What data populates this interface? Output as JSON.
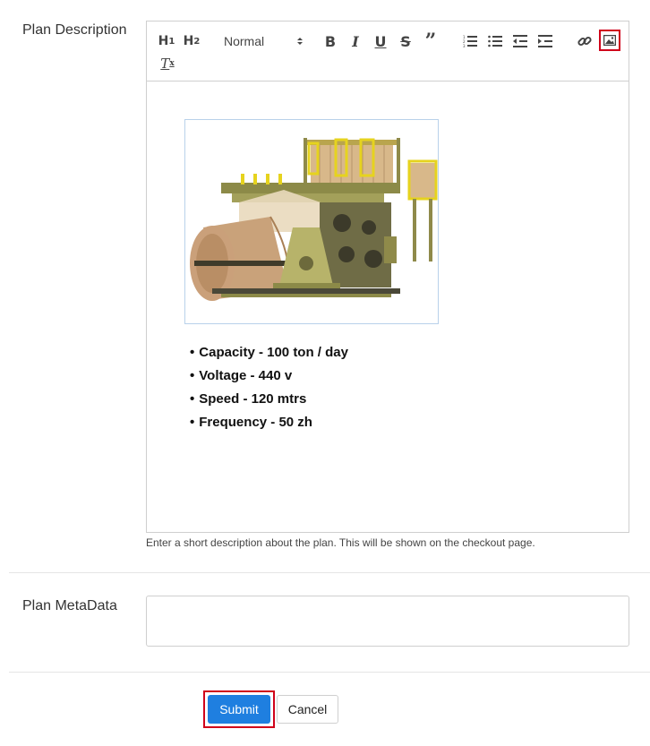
{
  "labels": {
    "plan_description": "Plan Description",
    "plan_metadata": "Plan MetaData"
  },
  "toolbar": {
    "h1": "H",
    "h1_sub": "1",
    "h2": "H",
    "h2_sub": "2",
    "format_select": "Normal",
    "bold": "B",
    "italic": "I",
    "underline": "U",
    "strike": "S",
    "quote": "”",
    "clear": "T",
    "clear_sub": "x",
    "icons": [
      "ordered-list-icon",
      "bullet-list-icon",
      "outdent-icon",
      "indent-icon",
      "link-icon",
      "image-icon",
      "clear-format-icon"
    ]
  },
  "content": {
    "image_description": "industrial paper machine with large kraft paper roll",
    "specs": [
      "Capacity - 100 ton / day",
      "Voltage - 440 v",
      "Speed - 120 mtrs",
      "Frequency - 50 zh"
    ]
  },
  "help_text": "Enter a short description about the plan. This will be shown on the checkout page.",
  "metadata_value": "",
  "buttons": {
    "submit": "Submit",
    "cancel": "Cancel"
  },
  "colors": {
    "submit_bg": "#1f7fe0",
    "highlight": "#d0021b"
  }
}
